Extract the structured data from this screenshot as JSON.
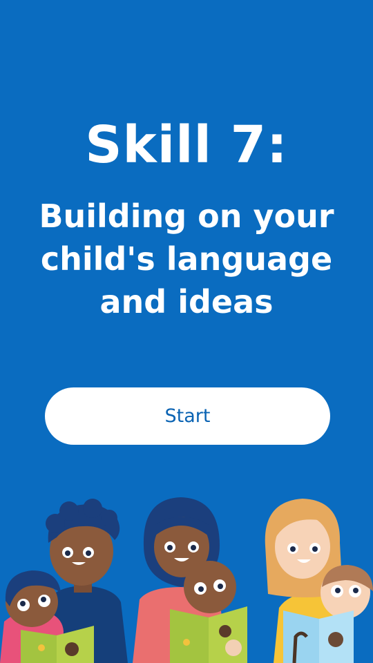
{
  "screen": {
    "title": "Skill 7:",
    "subtitle": "Building on your child's language and ideas",
    "start_button_label": "Start"
  },
  "colors": {
    "background": "#0a6cc0",
    "button_bg": "#ffffff",
    "button_text": "#0a63b3"
  },
  "illustration": {
    "description_icons": [
      "parent-reading-with-child-icon",
      "parent-in-hijab-reading-with-baby-icon",
      "parent-with-child-reading-book-icon"
    ]
  }
}
